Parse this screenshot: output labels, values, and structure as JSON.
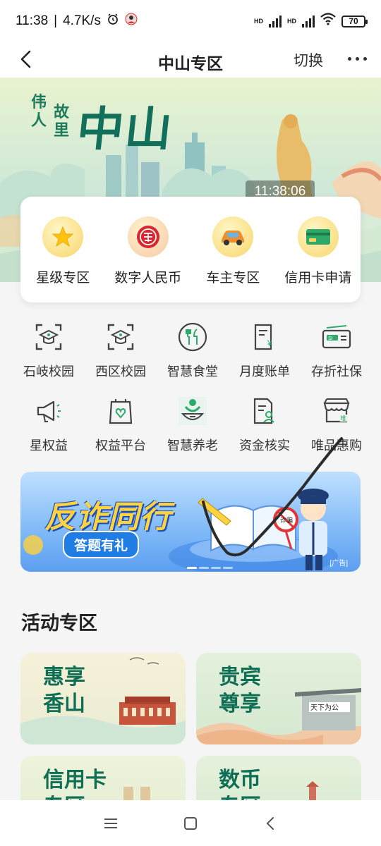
{
  "status_bar": {
    "time": "11:38",
    "speed": "4.7K/s",
    "battery": "70",
    "hd_1": "HD",
    "hd_2": "HD"
  },
  "nav": {
    "title": "中山专区",
    "switch_label": "切换"
  },
  "hero": {
    "small_text": [
      "伟",
      "人",
      "故",
      "里"
    ],
    "big_text": "中山",
    "clock": "11:38:06"
  },
  "quick_items": [
    {
      "label": "星级专区",
      "icon": "star-icon"
    },
    {
      "label": "数字人民币",
      "icon": "digital-rmb-icon"
    },
    {
      "label": "车主专区",
      "icon": "car-icon"
    },
    {
      "label": "信用卡申请",
      "icon": "credit-card-icon"
    }
  ],
  "grid_rows": [
    [
      {
        "label": "石岐校园",
        "icon": "campus-icon"
      },
      {
        "label": "西区校园",
        "icon": "campus-icon"
      },
      {
        "label": "智慧食堂",
        "icon": "canteen-icon"
      },
      {
        "label": "月度账单",
        "icon": "bill-icon"
      },
      {
        "label": "存折社保",
        "icon": "social-security-card-icon"
      }
    ],
    [
      {
        "label": "星权益",
        "icon": "megaphone-icon"
      },
      {
        "label": "权益平台",
        "icon": "rights-bag-icon"
      },
      {
        "label": "智慧养老",
        "icon": "elderly-care-icon"
      },
      {
        "label": "资金核实",
        "icon": "fund-verify-icon"
      },
      {
        "label": "唯品惠购",
        "icon": "shop-icon"
      }
    ]
  ],
  "banner": {
    "title": "反诈同行",
    "subtitle": "答题有礼",
    "ad_tag": "[广告]",
    "sign_text": "诈骗"
  },
  "activity": {
    "title": "活动专区",
    "cards": [
      {
        "line1": "惠享",
        "line2": "香山"
      },
      {
        "line1": "贵宾",
        "line2": "尊享",
        "sign": "天下为公"
      },
      {
        "line1": "信用卡",
        "line2": "专区"
      },
      {
        "line1": "数币",
        "line2": "专区"
      }
    ]
  },
  "colors": {
    "accent_green": "#12705a",
    "banner_blue": "#5c9ef0",
    "banner_yellow": "#ffd23f"
  }
}
